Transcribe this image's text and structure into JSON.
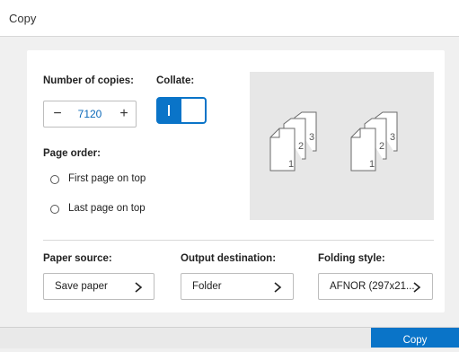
{
  "window": {
    "title": "Copy"
  },
  "copies": {
    "label": "Number of copies:",
    "value": "7120",
    "minus": "−",
    "plus": "+"
  },
  "collate": {
    "label": "Collate:",
    "state": "on"
  },
  "page_order": {
    "label": "Page order:",
    "options": [
      "First page on top",
      "Last page on top"
    ]
  },
  "preview": {
    "stack_left": [
      "1",
      "2",
      "3"
    ],
    "stack_right": [
      "1",
      "2",
      "3"
    ]
  },
  "paper_source": {
    "label": "Paper source:",
    "value": "Save paper"
  },
  "output_destination": {
    "label": "Output destination:",
    "value": "Folder"
  },
  "folding_style": {
    "label": "Folding style:",
    "value": "AFNOR (297x21..."
  },
  "footer": {
    "copy_label": "Copy"
  },
  "colors": {
    "accent": "#0a74c8",
    "panel": "#ffffff",
    "background": "#f0f0f0",
    "preview_bg": "#e7e7e7"
  },
  "icons": [
    "chevron-right-icon",
    "collated-pages-icon",
    "radio-icon"
  ]
}
